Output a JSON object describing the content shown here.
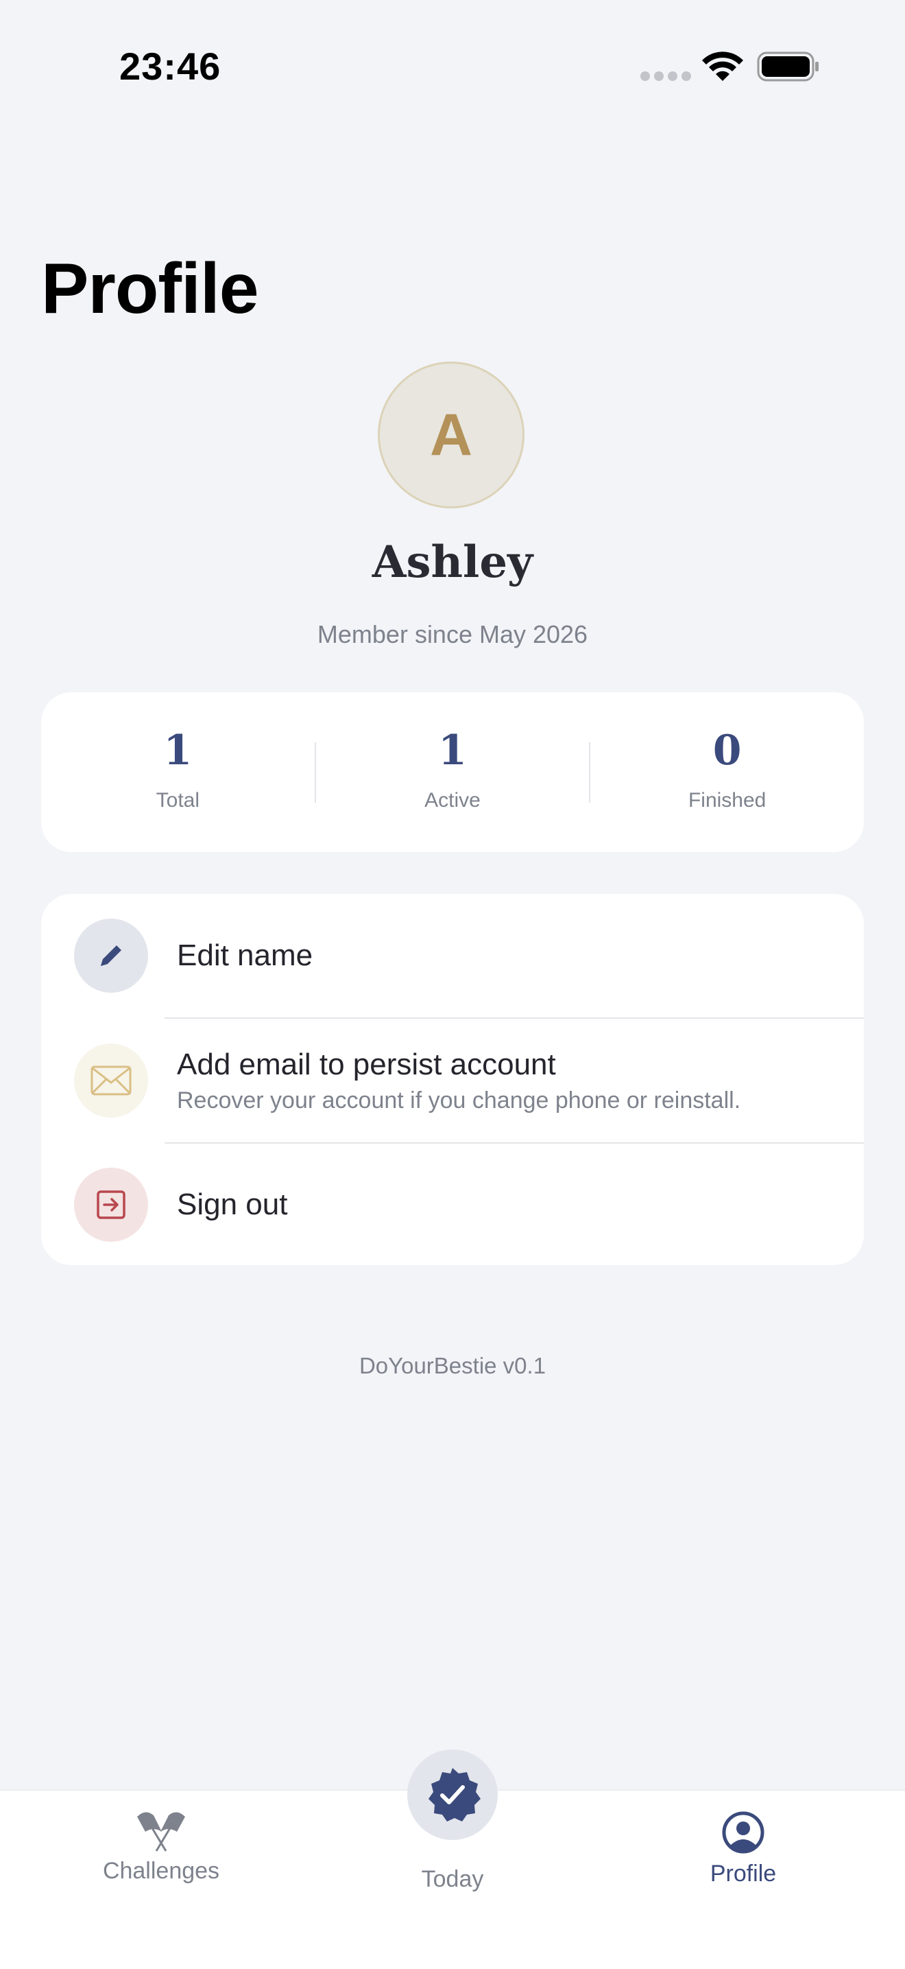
{
  "status_bar": {
    "time": "23:46"
  },
  "page": {
    "title": "Profile"
  },
  "profile": {
    "avatar_initial": "A",
    "name": "Ashley",
    "member_since": "Member since May 2026"
  },
  "stats": [
    {
      "value": "1",
      "label": "Total"
    },
    {
      "value": "1",
      "label": "Active"
    },
    {
      "value": "0",
      "label": "Finished"
    }
  ],
  "menu": {
    "edit_name": {
      "label": "Edit name",
      "icon": "pencil-icon"
    },
    "add_email": {
      "label": "Add email to persist account",
      "sublabel": "Recover your account if you change phone or reinstall.",
      "icon": "envelope-icon"
    },
    "sign_out": {
      "label": "Sign out",
      "icon": "sign-out-icon"
    }
  },
  "app_version": "DoYourBestie v0.1",
  "tab_bar": {
    "tabs": [
      {
        "label": "Challenges",
        "icon": "flags-icon",
        "active": false
      },
      {
        "label": "Today",
        "icon": "check-badge-icon",
        "active": false
      },
      {
        "label": "Profile",
        "icon": "person-circle-icon",
        "active": true
      }
    ]
  },
  "colors": {
    "background": "#F3F4F8",
    "accent": "#3B4A7C",
    "gold": "#B39158",
    "danger": "#B8484E",
    "muted_text": "#7D828C"
  }
}
